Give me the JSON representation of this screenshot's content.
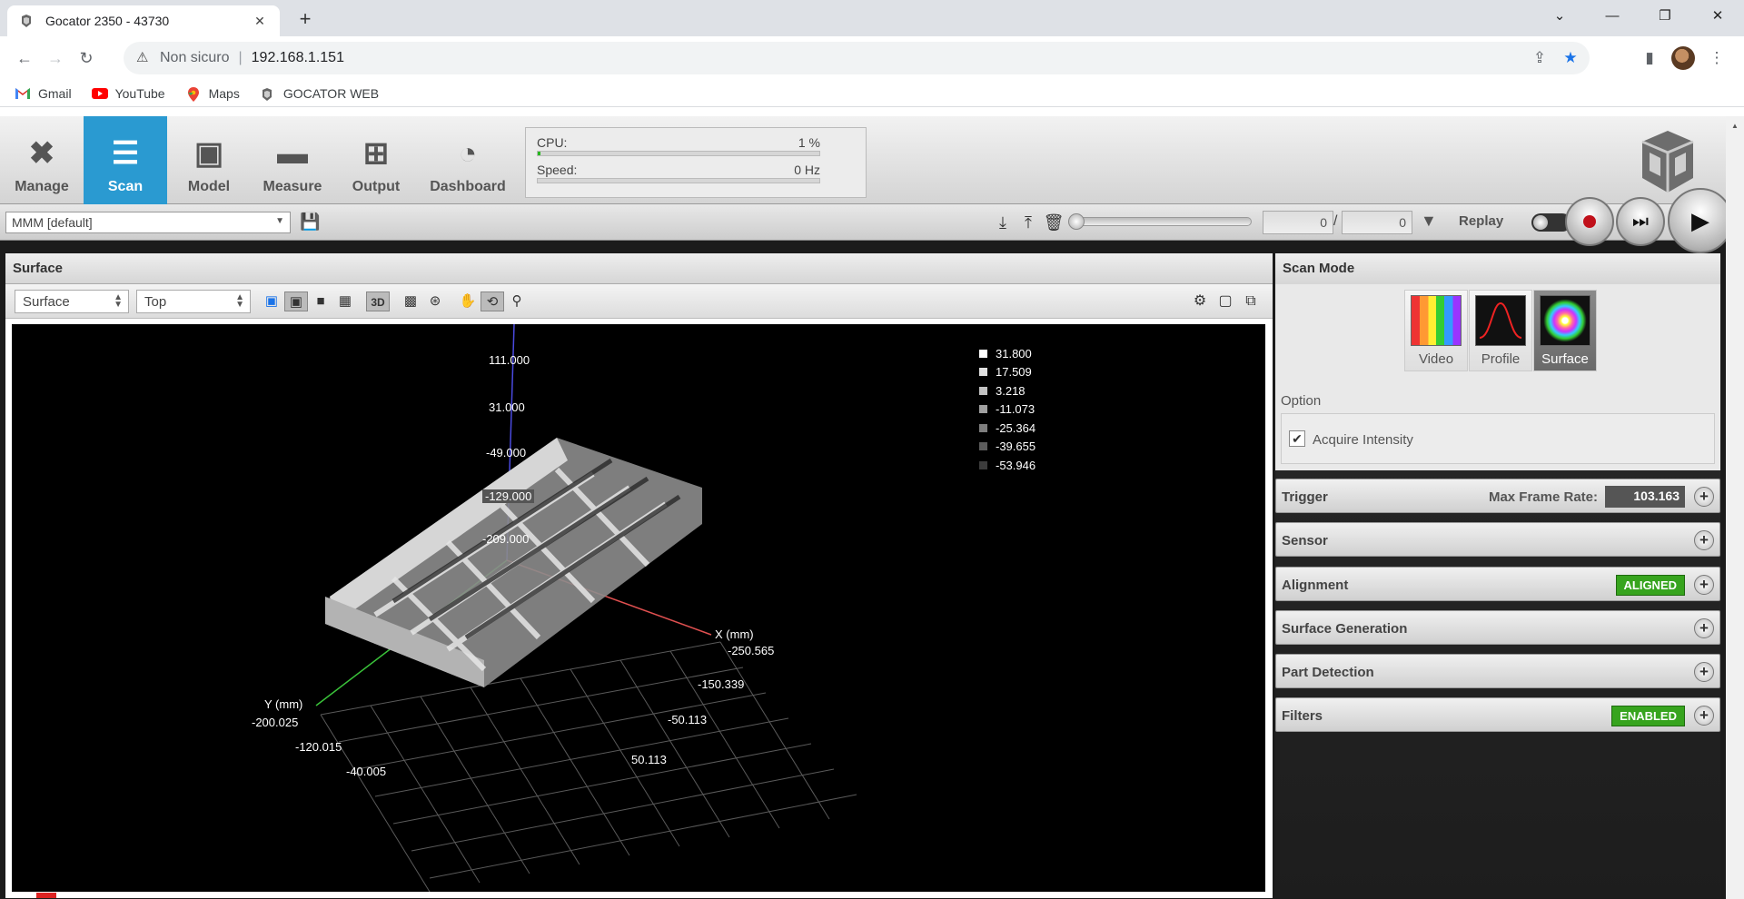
{
  "browser": {
    "tab_title": "Gocator 2350 - 43730",
    "security_label": "Non sicuro",
    "url": "192.168.1.151",
    "bookmarks": [
      {
        "label": "Gmail",
        "icon": "gmail-icon"
      },
      {
        "label": "YouTube",
        "icon": "youtube-icon"
      },
      {
        "label": "Maps",
        "icon": "maps-icon"
      },
      {
        "label": "GOCATOR WEB",
        "icon": "gocator-icon"
      }
    ]
  },
  "nav": {
    "items": [
      {
        "label": "Manage",
        "icon": "tools-icon"
      },
      {
        "label": "Scan",
        "icon": "scan-icon",
        "active": true
      },
      {
        "label": "Model",
        "icon": "model-icon"
      },
      {
        "label": "Measure",
        "icon": "measure-icon"
      },
      {
        "label": "Output",
        "icon": "output-icon"
      },
      {
        "label": "Dashboard",
        "icon": "dashboard-icon"
      }
    ]
  },
  "stats": {
    "cpu_label": "CPU:",
    "cpu_value": "1 %",
    "cpu_fraction": 0.01,
    "speed_label": "Speed:",
    "speed_value": "0 Hz",
    "speed_fraction": 0
  },
  "toolbar": {
    "job": "MMM [default]",
    "frame_current": "0",
    "frame_total": "0",
    "replay_label": "Replay"
  },
  "surface_panel": {
    "title": "Surface",
    "view_select": "Surface",
    "orientation_select": "Top",
    "z_labels": [
      "111.000",
      "31.000",
      "-49.000",
      "-129.000",
      "-209.000"
    ],
    "x_axis_label": "X (mm)",
    "x_ticks": [
      "-250.565",
      "-150.339",
      "-50.113",
      "50.113"
    ],
    "y_axis_label": "Y (mm)",
    "y_ticks": [
      "-200.025",
      "-120.015",
      "-40.005"
    ],
    "legend": [
      {
        "value": "31.800",
        "color": "#ffffff"
      },
      {
        "value": "17.509",
        "color": "#e0e0e0"
      },
      {
        "value": "3.218",
        "color": "#c2c2c2"
      },
      {
        "value": "-11.073",
        "color": "#a0a0a0"
      },
      {
        "value": "-25.364",
        "color": "#7e7e7e"
      },
      {
        "value": "-39.655",
        "color": "#5c5c5c"
      },
      {
        "value": "-53.946",
        "color": "#3c3c3c"
      }
    ]
  },
  "right_panel": {
    "title": "Scan Mode",
    "modes": [
      {
        "label": "Video",
        "selected": false
      },
      {
        "label": "Profile",
        "selected": false
      },
      {
        "label": "Surface",
        "selected": true
      }
    ],
    "option_label": "Option",
    "acquire_intensity_label": "Acquire Intensity",
    "acquire_intensity_checked": true,
    "sections": {
      "trigger": "Trigger",
      "max_frame_rate_label": "Max Frame Rate:",
      "max_frame_rate_value": "103.163",
      "sensor": "Sensor",
      "alignment": "Alignment",
      "alignment_badge": "ALIGNED",
      "surface_generation": "Surface Generation",
      "part_detection": "Part Detection",
      "filters": "Filters",
      "filters_badge": "ENABLED"
    }
  }
}
